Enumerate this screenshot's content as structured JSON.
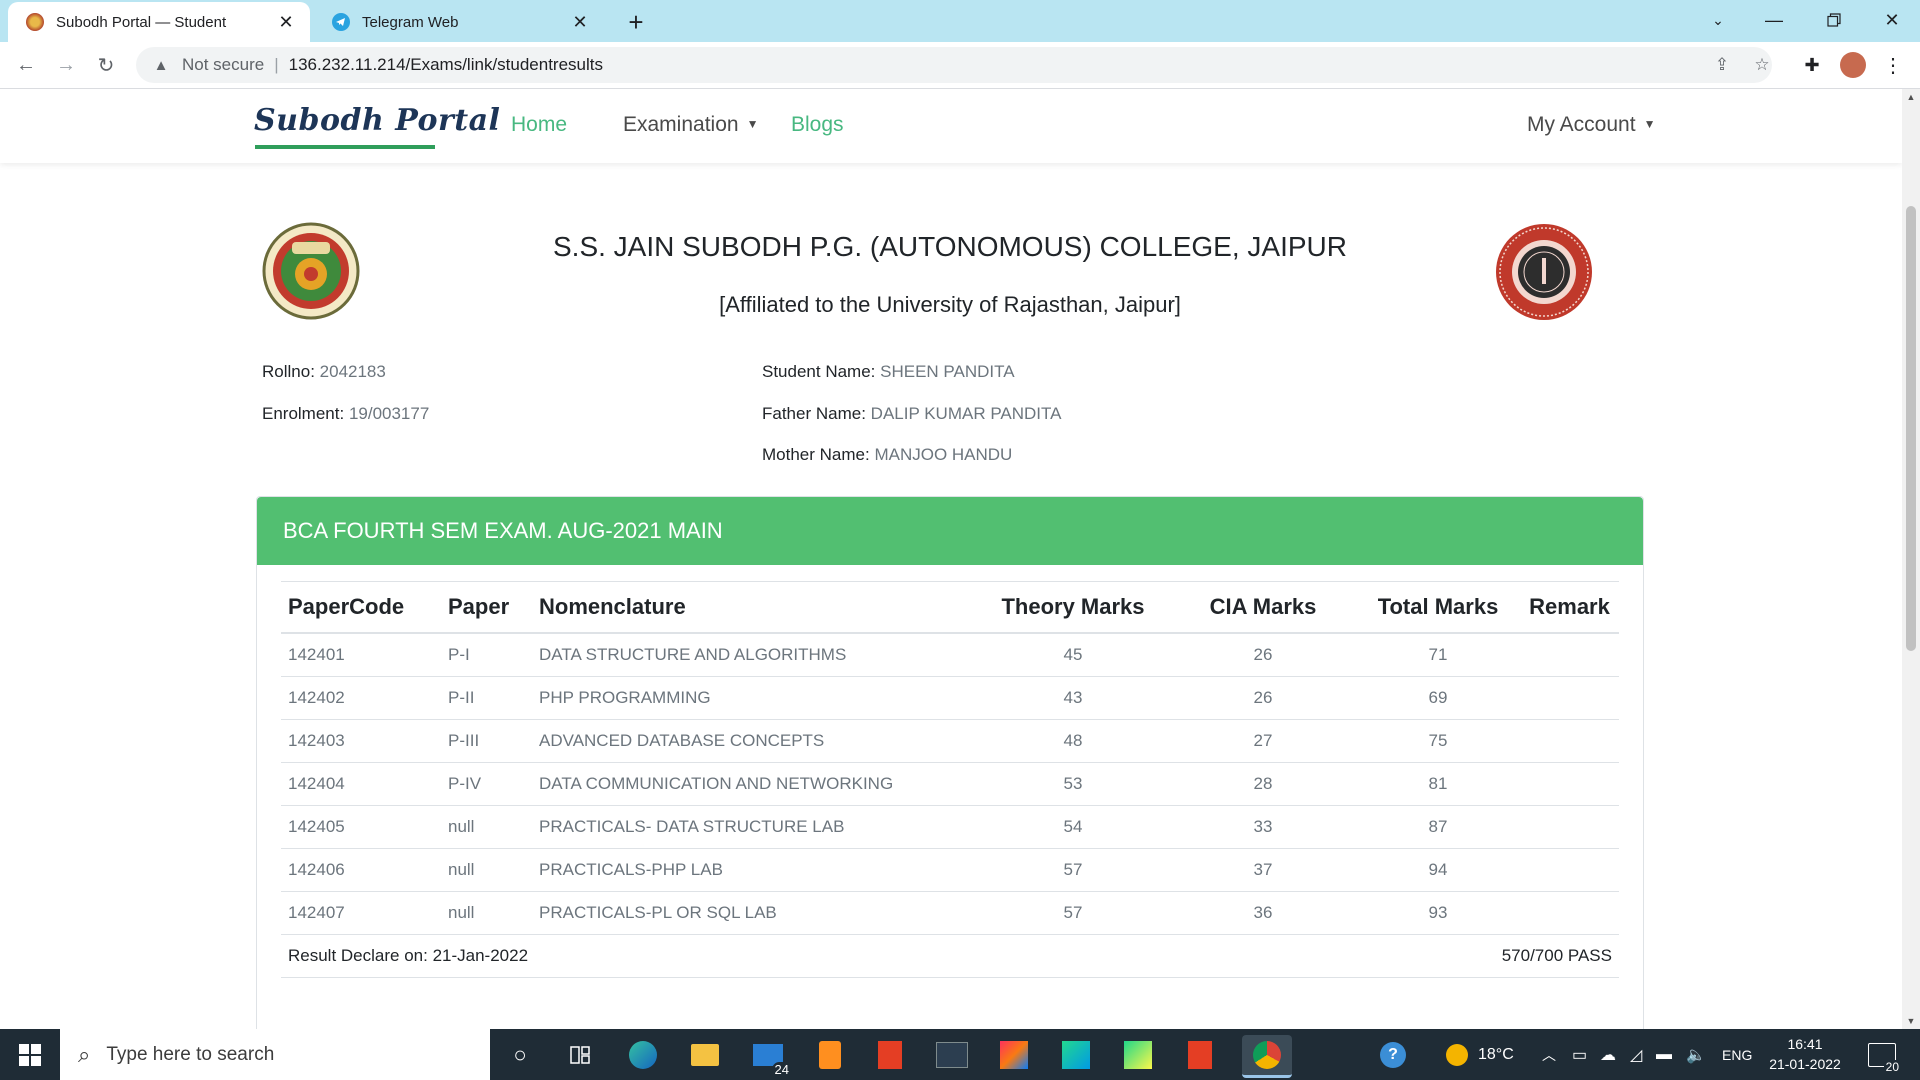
{
  "browser": {
    "tabs": [
      {
        "title": "Subodh Portal — Student",
        "active": true
      },
      {
        "title": "Telegram Web",
        "active": false
      }
    ],
    "address": {
      "security_label": "Not secure",
      "separator": "|",
      "url": "136.232.11.214/Exams/link/studentresults"
    }
  },
  "site": {
    "logo": "Subodh Portal",
    "nav": {
      "home": "Home",
      "examination": "Examination",
      "blogs": "Blogs",
      "account": "My Account"
    }
  },
  "header": {
    "college": "S.S. JAIN SUBODH P.G. (AUTONOMOUS) COLLEGE, JAIPUR",
    "affiliation": "[Affiliated to the University of Rajasthan, Jaipur]"
  },
  "student": {
    "rollno_label": "Rollno:",
    "rollno": "2042183",
    "enrolment_label": "Enrolment:",
    "enrolment": "19/003177",
    "name_label": "Student Name:",
    "name": "SHEEN PANDITA",
    "father_label": "Father Name:",
    "father": "DALIP KUMAR PANDITA",
    "mother_label": "Mother Name:",
    "mother": "MANJOO HANDU"
  },
  "result": {
    "exam_title": "BCA FOURTH SEM EXAM. AUG-2021 MAIN",
    "columns": {
      "code": "PaperCode",
      "paper": "Paper",
      "nomenclature": "Nomenclature",
      "theory": "Theory Marks",
      "cia": "CIA Marks",
      "total": "Total Marks",
      "remark": "Remark"
    },
    "rows": [
      {
        "code": "142401",
        "paper": "P-I",
        "name": "DATA STRUCTURE AND ALGORITHMS",
        "theory": "45",
        "cia": "26",
        "total": "71",
        "remark": ""
      },
      {
        "code": "142402",
        "paper": "P-II",
        "name": "PHP PROGRAMMING",
        "theory": "43",
        "cia": "26",
        "total": "69",
        "remark": ""
      },
      {
        "code": "142403",
        "paper": "P-III",
        "name": "ADVANCED DATABASE CONCEPTS",
        "theory": "48",
        "cia": "27",
        "total": "75",
        "remark": ""
      },
      {
        "code": "142404",
        "paper": "P-IV",
        "name": "DATA COMMUNICATION AND NETWORKING",
        "theory": "53",
        "cia": "28",
        "total": "81",
        "remark": ""
      },
      {
        "code": "142405",
        "paper": "null",
        "name": "PRACTICALS- DATA STRUCTURE LAB",
        "theory": "54",
        "cia": "33",
        "total": "87",
        "remark": ""
      },
      {
        "code": "142406",
        "paper": "null",
        "name": "PRACTICALS-PHP LAB",
        "theory": "57",
        "cia": "37",
        "total": "94",
        "remark": ""
      },
      {
        "code": "142407",
        "paper": "null",
        "name": "PRACTICALS-PL OR SQL LAB",
        "theory": "57",
        "cia": "36",
        "total": "93",
        "remark": ""
      }
    ],
    "declared": "Result Declare on: 21-Jan-2022",
    "summary": "570/700 PASS"
  },
  "taskbar": {
    "search_placeholder": "Type here to search",
    "mail_badge": "24",
    "weather": "18°C",
    "language": "ENG",
    "time": "16:41",
    "date": "21-01-2022",
    "notification_count": "20"
  },
  "colors": {
    "accent_green": "#52bf71",
    "nav_green": "#48b881",
    "tab_strip": "#b9e5f2",
    "taskbar": "#1f2c36"
  }
}
